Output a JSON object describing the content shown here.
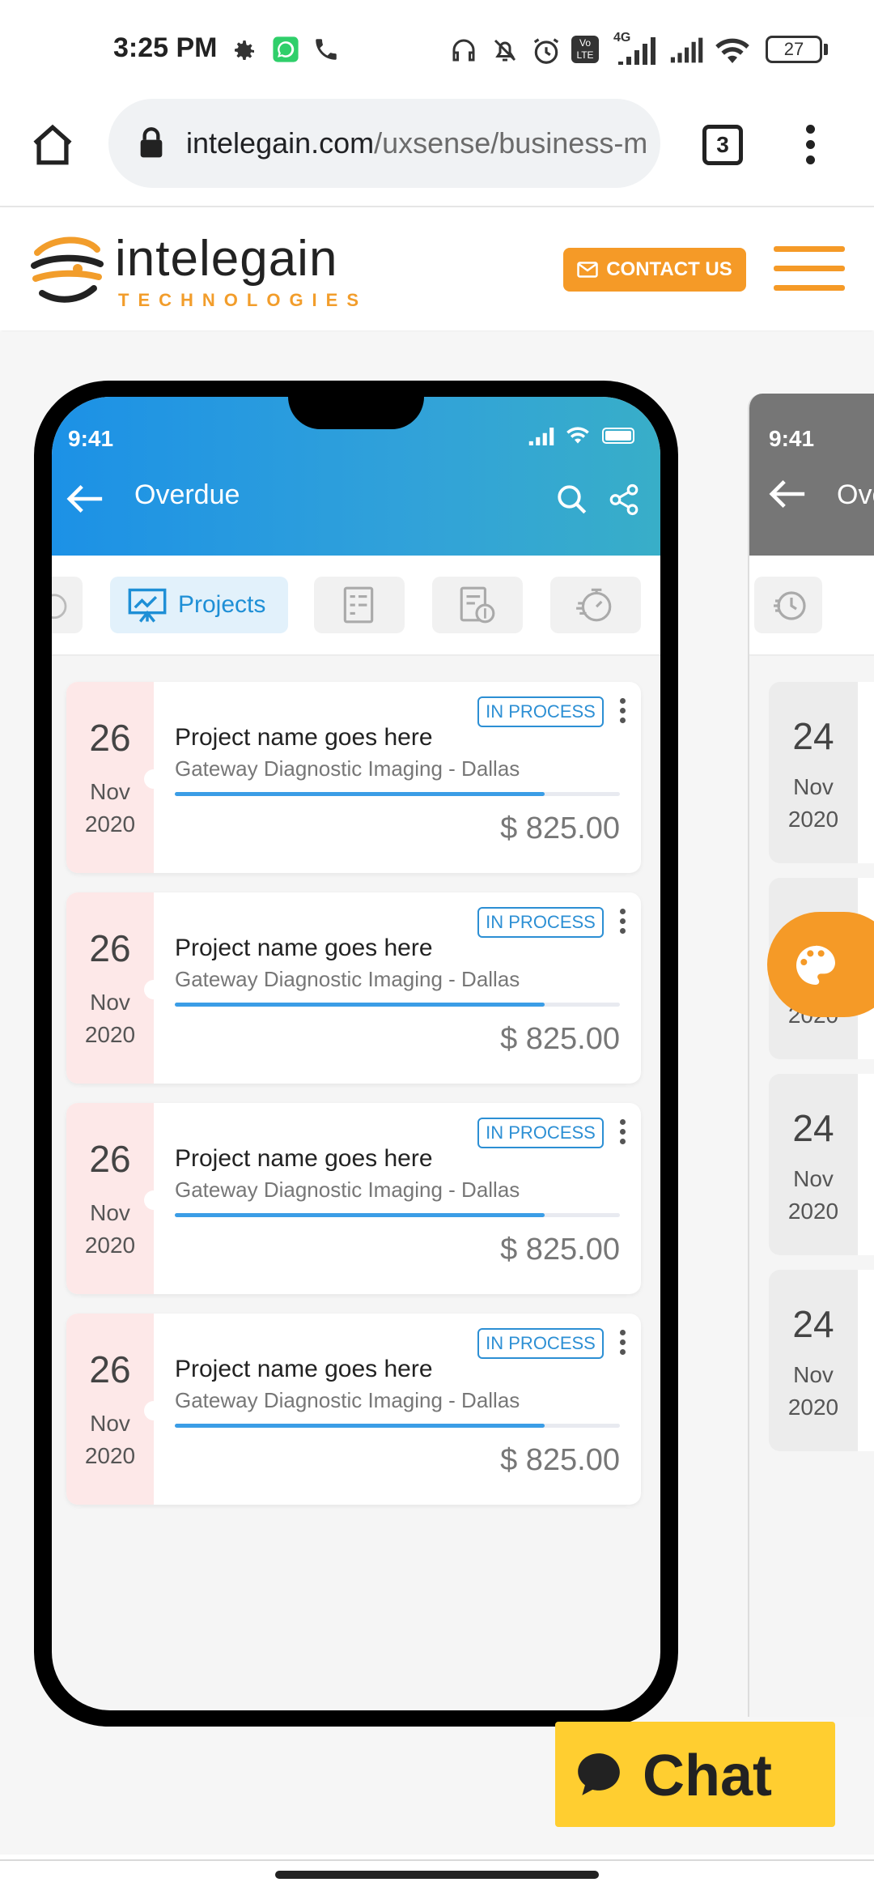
{
  "status_bar": {
    "time": "3:25 PM",
    "battery": "27",
    "network": "4G",
    "volte": "Vo LTE",
    "icons": [
      "gear-icon",
      "whatsapp-icon",
      "phone-icon",
      "headphones-icon",
      "mute-icon",
      "alarm-icon",
      "signal-icon",
      "signal-icon",
      "wifi-icon",
      "battery-icon"
    ]
  },
  "browser": {
    "url_host": "intelegain.com",
    "url_path": "/uxsense/business-m",
    "tab_count": "3"
  },
  "site_header": {
    "logo_word": "intelegain",
    "logo_sub": "TECHNOLOGIES",
    "contact_label": "CONTACT US"
  },
  "phone1": {
    "time": "9:41",
    "title": "Overdue",
    "tabs": [
      {
        "label": "",
        "icon": "timer-icon"
      },
      {
        "label": "Projects",
        "icon": "presentation-chart-icon",
        "active": true
      },
      {
        "label": "",
        "icon": "checklist-icon"
      },
      {
        "label": "",
        "icon": "invoice-dollar-icon"
      },
      {
        "label": "",
        "icon": "stopwatch-icon"
      }
    ],
    "cards": [
      {
        "day": "26",
        "month": "Nov",
        "year": "2020",
        "status": "IN PROCESS",
        "name": "Project name goes here",
        "client": "Gateway Diagnostic Imaging - Dallas",
        "amount": "$ 825.00",
        "progress": 0.83
      },
      {
        "day": "26",
        "month": "Nov",
        "year": "2020",
        "status": "IN PROCESS",
        "name": "Project name goes here",
        "client": "Gateway Diagnostic Imaging - Dallas",
        "amount": "$ 825.00",
        "progress": 0.83
      },
      {
        "day": "26",
        "month": "Nov",
        "year": "2020",
        "status": "IN PROCESS",
        "name": "Project name goes here",
        "client": "Gateway Diagnostic Imaging - Dallas",
        "amount": "$ 825.00",
        "progress": 0.83
      },
      {
        "day": "26",
        "month": "Nov",
        "year": "2020",
        "status": "IN PROCESS",
        "name": "Project name goes here",
        "client": "Gateway Diagnostic Imaging - Dallas",
        "amount": "$ 825.00",
        "progress": 0.83
      }
    ]
  },
  "phone2": {
    "time": "9:41",
    "title_partial": "Ove",
    "cards": [
      {
        "day": "24",
        "month": "Nov",
        "year": "2020"
      },
      {
        "day": "",
        "month": "",
        "year": "2020"
      },
      {
        "day": "24",
        "month": "Nov",
        "year": "2020"
      },
      {
        "day": "24",
        "month": "Nov",
        "year": "2020"
      }
    ]
  },
  "chat": {
    "label": "Chat"
  },
  "colors": {
    "accent_orange": "#f59a27",
    "accent_blue": "#1e8fd6",
    "chat_yellow": "#ffce30"
  }
}
